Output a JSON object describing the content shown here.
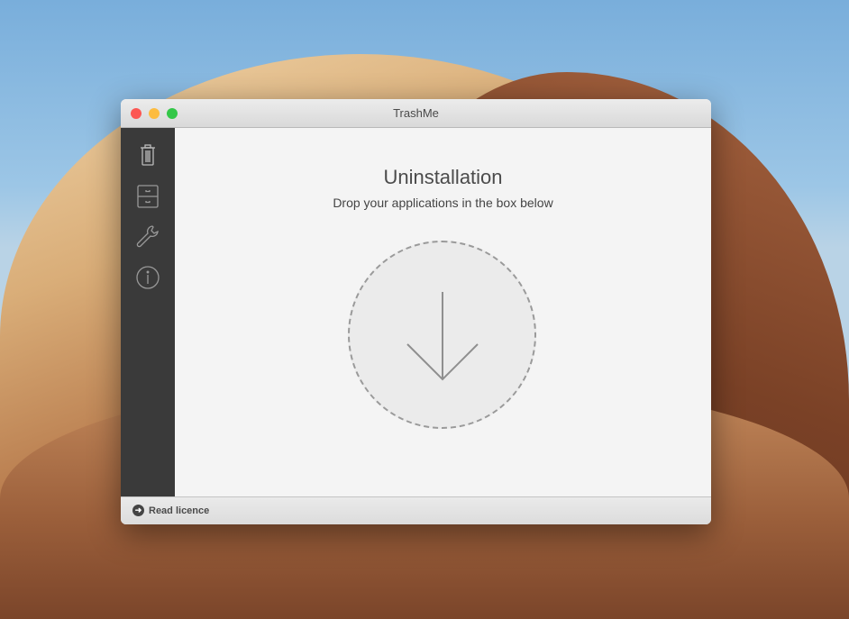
{
  "window": {
    "title": "TrashMe"
  },
  "sidebar": {
    "items": [
      {
        "icon": "trash-icon"
      },
      {
        "icon": "drawer-icon"
      },
      {
        "icon": "wrench-icon"
      },
      {
        "icon": "info-icon"
      }
    ]
  },
  "main": {
    "title": "Uninstallation",
    "subtitle": "Drop your applications in the box below"
  },
  "footer": {
    "licence_label": "Read licence"
  },
  "colors": {
    "close": "#fc5753",
    "minimize": "#fdbc40",
    "zoom": "#33c748",
    "sidebar": "#3a3a3a"
  }
}
